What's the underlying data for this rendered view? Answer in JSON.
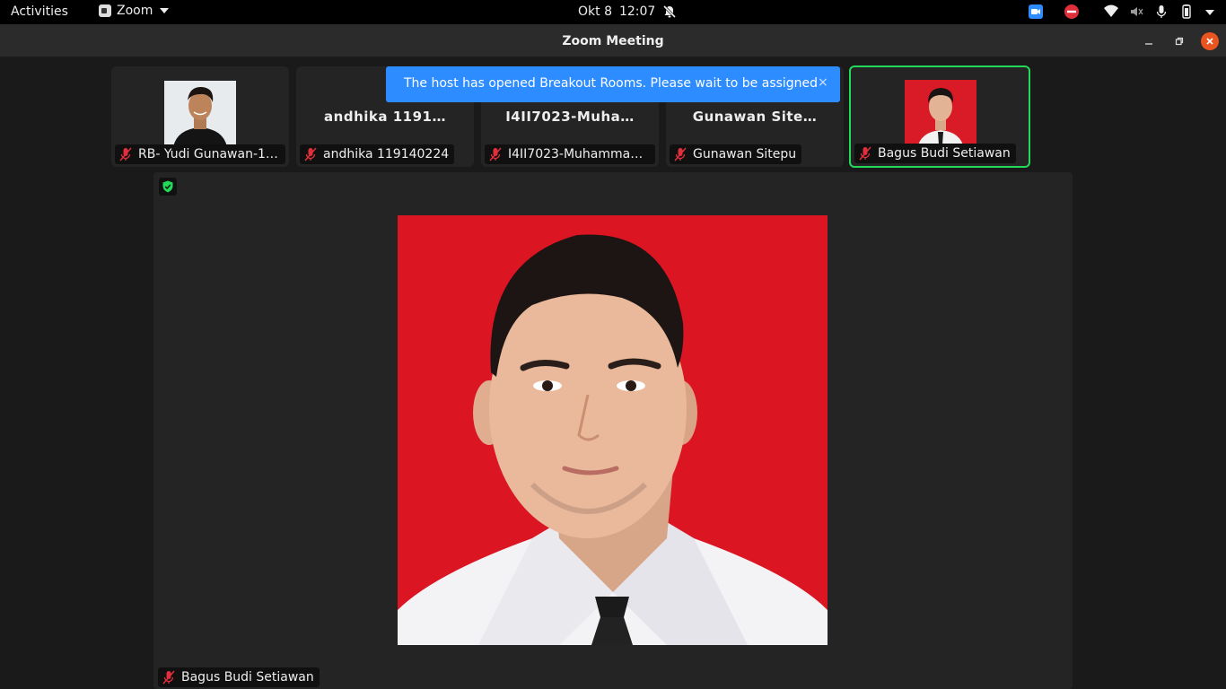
{
  "topbar": {
    "activities": "Activities",
    "app_name": "Zoom",
    "date": "Okt 8",
    "time": "12:07"
  },
  "window": {
    "title": "Zoom Meeting"
  },
  "notification": {
    "text": "The host has opened Breakout Rooms. Please wait to be assigned",
    "close": "×"
  },
  "participants": [
    {
      "tile_name": "",
      "label": "RB- Yudi Gunawan-14…",
      "mic": "muted",
      "has_video": true
    },
    {
      "tile_name": "andhika 1191…",
      "label": "andhika 119140224",
      "mic": "muted",
      "has_video": false
    },
    {
      "tile_name": "I4II7023-Muha…",
      "label": "I4II7023-Muhammad I…",
      "mic": "muted",
      "has_video": false
    },
    {
      "tile_name": "Gunawan Site…",
      "label": "Gunawan Sitepu",
      "mic": "muted",
      "has_video": false
    },
    {
      "tile_name": "",
      "label": "Bagus Budi Setiawan",
      "mic": "muted",
      "has_video": true,
      "active_speaker": true
    }
  ],
  "main_speaker": {
    "label": "Bagus Budi Setiawan",
    "mic": "muted"
  },
  "colors": {
    "accent_blue": "#2d8cff",
    "active_green": "#23d959",
    "photo_red": "#dc1523",
    "mute_red": "#e02f3b",
    "close_orange": "#e95420"
  }
}
